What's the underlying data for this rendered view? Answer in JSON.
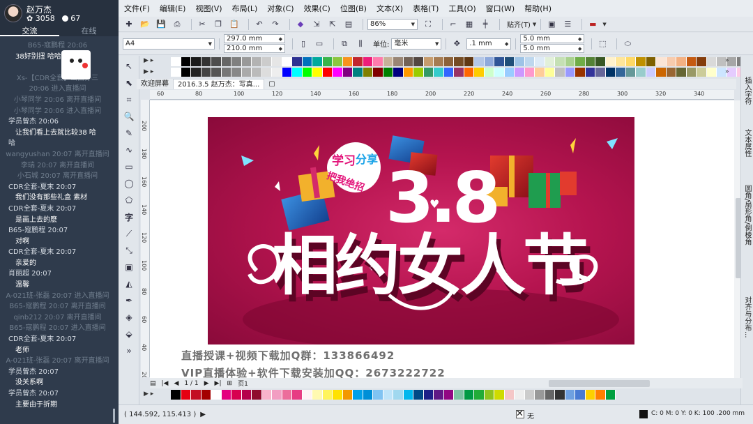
{
  "chat": {
    "user": "赵万杰",
    "stat1": "3058",
    "stat2": "67",
    "tabs": [
      "交流",
      "在线"
    ],
    "messages": [
      {
        "k": "s",
        "t": "B65-寇鹏程 20:06"
      },
      {
        "k": "t",
        "t": "38好别扭  哈哈"
      },
      {
        "k": "s",
        "t": ""
      },
      {
        "k": "s",
        "t": "Xs-【CDR全套】山西孙三"
      },
      {
        "k": "s",
        "t": "20:06 进入直播间"
      },
      {
        "k": "s",
        "t": "小琴同学 20:06 离开直播间"
      },
      {
        "k": "s",
        "t": "小琴同学 20:06 进入直播间"
      },
      {
        "k": "n",
        "t": "学员曾杰 20:06"
      },
      {
        "k": "t",
        "t": "让我们看上去就比较38 哈"
      },
      {
        "k": "n",
        "t": "哈"
      },
      {
        "k": "s",
        "t": "wangyushan 20:07 离开直播间"
      },
      {
        "k": "s",
        "t": "李瑞 20:07 离开直播间"
      },
      {
        "k": "s",
        "t": "小石城 20:07 离开直播间"
      },
      {
        "k": "n",
        "t": "CDR全套-夏末 20:07"
      },
      {
        "k": "t",
        "t": "我们没有那些礼盒 素材"
      },
      {
        "k": "n",
        "t": "CDR全套-夏末 20:07"
      },
      {
        "k": "t",
        "t": "是画上去的麽"
      },
      {
        "k": "n",
        "t": "B65-寇鹏程 20:07"
      },
      {
        "k": "t",
        "t": "对啊"
      },
      {
        "k": "n",
        "t": "CDR全套-夏末 20:07"
      },
      {
        "k": "t",
        "t": "亲爱的"
      },
      {
        "k": "n",
        "t": "肖丽超 20:07"
      },
      {
        "k": "t",
        "t": "温馨"
      },
      {
        "k": "s",
        "t": "A-021班-张磊 20:07 进入直播间"
      },
      {
        "k": "s",
        "t": "B65-寇鹏程 20:07 离开直播间"
      },
      {
        "k": "s",
        "t": "qinb212 20:07 离开直播间"
      },
      {
        "k": "s",
        "t": "B65-寇鹏程 20:07 进入直播间"
      },
      {
        "k": "n",
        "t": "CDR全套-夏末 20:07"
      },
      {
        "k": "t",
        "t": "老师"
      },
      {
        "k": "s",
        "t": "A-021班-张磊 20:07 离开直播间"
      },
      {
        "k": "n",
        "t": "学员曾杰 20:07"
      },
      {
        "k": "t",
        "t": "没关系啊"
      },
      {
        "k": "n",
        "t": "学员曾杰 20:07"
      },
      {
        "k": "t",
        "t": "主要由于折期"
      }
    ]
  },
  "menu": [
    "文件(F)",
    "编辑(E)",
    "视图(V)",
    "布局(L)",
    "对象(C)",
    "效果(C)",
    "位图(B)",
    "文本(X)",
    "表格(T)",
    "工具(O)",
    "窗口(W)",
    "帮助(H)"
  ],
  "toolbar1": {
    "zoom": "86%",
    "snap": "贴齐(T)"
  },
  "toolbar2": {
    "paper": "A4",
    "width": "297.0 mm",
    "height": "210.0 mm",
    "unit_label": "单位:",
    "unit": "毫米",
    "nudge": ".1 mm",
    "dup_x": "5.0 mm",
    "dup_y": "5.0 mm"
  },
  "doc_tabs": [
    "欢迎屏幕",
    "2016.3.5 赵万杰：写真..."
  ],
  "ruler_h": [
    "60",
    "80",
    "100",
    "120",
    "140",
    "160",
    "180",
    "200",
    "220",
    "240",
    "260",
    "280",
    "300",
    "320",
    "340"
  ],
  "ruler_v": [
    "200",
    "180",
    "160",
    "140",
    "120",
    "100",
    "80",
    "60",
    "40",
    "20"
  ],
  "poster": {
    "badge_top": "学习",
    "badge_mid": "分享",
    "badge_bottom": "把我绝招",
    "number": "3.8",
    "headline": "相约女人节"
  },
  "overlay": {
    "line1": "直播授课+视频下载加Q群：133866492",
    "line2": "VIP直播体验+软件下载安装加QQ：2673222722"
  },
  "dockers": [
    "插入字符",
    "文本属性",
    "圆角/扇形角/倒棱角",
    "对齐与分布..."
  ],
  "pagenav": {
    "pages": "1 / 1",
    "page_tab": "页1"
  },
  "status": {
    "coords": "( 144.592, 115.413 )",
    "fill": "无",
    "outline": "C: 0 M: 0 Y: 0 K: 100  .200 mm"
  },
  "colors": {
    "palette_top1": [
      "#ffffff",
      "#000000",
      "#1a1a1a",
      "#333333",
      "#4d4d4d",
      "#666666",
      "#808080",
      "#999999",
      "#b3b3b3",
      "#cccccc",
      "#e6e6e6",
      "#ffffff",
      "#2e3192",
      "#0071bc",
      "#00a99d",
      "#39b54a",
      "#8cc63f",
      "#f7931e",
      "#c1272d",
      "#ed1e79",
      "#ff7bac",
      "#c7b299",
      "#998675",
      "#736357",
      "#534741",
      "#c69c6d",
      "#a67c52",
      "#8c6239",
      "#754c24",
      "#603813",
      "#b4c7e7",
      "#8faadc",
      "#2f5597",
      "#1f4e79",
      "#9dc3e6",
      "#bdd7ee",
      "#deebf7",
      "#e2f0d9",
      "#c5e0b4",
      "#a9d18e",
      "#70ad47",
      "#548235",
      "#385723",
      "#fff2cc",
      "#ffe699",
      "#ffd966",
      "#bf9000",
      "#7f6000",
      "#fbe5d6",
      "#f8cbad",
      "#f4b183",
      "#c55a11",
      "#843c0c",
      "#d9d9d9",
      "#bfbfbf",
      "#a6a6a6",
      "#7f7f7f",
      "#595959"
    ],
    "palette_top2": [
      "#ffffff",
      "#000000",
      "#222222",
      "#444444",
      "#555555",
      "#777777",
      "#888888",
      "#aaaaaa",
      "#bbbbbb",
      "#dddddd",
      "#eeeeee",
      "#0000ff",
      "#00ffff",
      "#00ff00",
      "#ffff00",
      "#ff0000",
      "#ff00ff",
      "#800080",
      "#008080",
      "#808000",
      "#800000",
      "#008000",
      "#000080",
      "#ff9900",
      "#99cc00",
      "#339966",
      "#33cccc",
      "#3366ff",
      "#993366",
      "#ff6600",
      "#ffcc00",
      "#ccffcc",
      "#ccffff",
      "#99ccff",
      "#cc99ff",
      "#ff99cc",
      "#ffcc99",
      "#ffff99",
      "#c0c0c0",
      "#9999ff",
      "#993300",
      "#333399",
      "#666699",
      "#003366",
      "#336699",
      "#669999",
      "#99cccc",
      "#ccccff",
      "#cc6600",
      "#996633",
      "#666633",
      "#999966",
      "#cccc99",
      "#ffffcc",
      "#cce5ff",
      "#e5ccff",
      "#ffcce5",
      "#ffe5cc"
    ],
    "palette_bottom": [
      "#000000",
      "#e60012",
      "#c30d23",
      "#a40000",
      "#ffffff",
      "#e4007f",
      "#d7004f",
      "#b5004a",
      "#8f0c2d",
      "#f8b4cb",
      "#f29ec2",
      "#ec6d9b",
      "#e73c83",
      "#fef2f6",
      "#fff9b1",
      "#fff45c",
      "#ffe100",
      "#f39800",
      "#00a0e9",
      "#008fd7",
      "#80c3f2",
      "#bfe4f9",
      "#a0d8ef",
      "#00b7ee",
      "#004986",
      "#1d2088",
      "#601986",
      "#920783",
      "#7dc1a3",
      "#009944",
      "#22ac38",
      "#8fc31f",
      "#cfdb00",
      "#f5c7c7",
      "#eeeeee",
      "#cccccc",
      "#999999",
      "#666666",
      "#333333",
      "#6fa0e0",
      "#4a7bd3",
      "#fdd000",
      "#ff7f00",
      "#00a040"
    ],
    "accent": "#3466c4"
  }
}
